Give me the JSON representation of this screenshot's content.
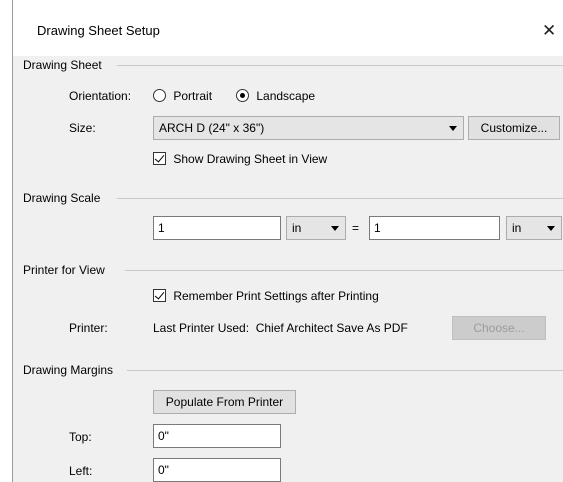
{
  "dialog": {
    "title": "Drawing Sheet Setup",
    "close_glyph": "✕"
  },
  "drawing_sheet": {
    "section_title": "Drawing Sheet",
    "orientation_label": "Orientation:",
    "portrait_label": "Portrait",
    "landscape_label": "Landscape",
    "selected_orientation": "Landscape",
    "size_label": "Size:",
    "size_value": "ARCH D  (24\" x 36\")",
    "customize_label": "Customize...",
    "show_sheet_label": "Show Drawing Sheet in View",
    "show_sheet_checked": true
  },
  "drawing_scale": {
    "section_title": "Drawing Scale",
    "left_value": "1",
    "left_unit": "in",
    "equals": "=",
    "right_value": "1",
    "right_unit": "in"
  },
  "printer_for_view": {
    "section_title": "Printer for View",
    "remember_label": "Remember Print Settings after Printing",
    "remember_checked": true,
    "printer_label": "Printer:",
    "printer_value": "Last Printer Used:  Chief Architect Save As PDF",
    "choose_label": "Choose..."
  },
  "drawing_margins": {
    "section_title": "Drawing Margins",
    "populate_label": "Populate From Printer",
    "top_label": "Top:",
    "top_value": "0\"",
    "left_label": "Left:",
    "left_value": "0\""
  }
}
